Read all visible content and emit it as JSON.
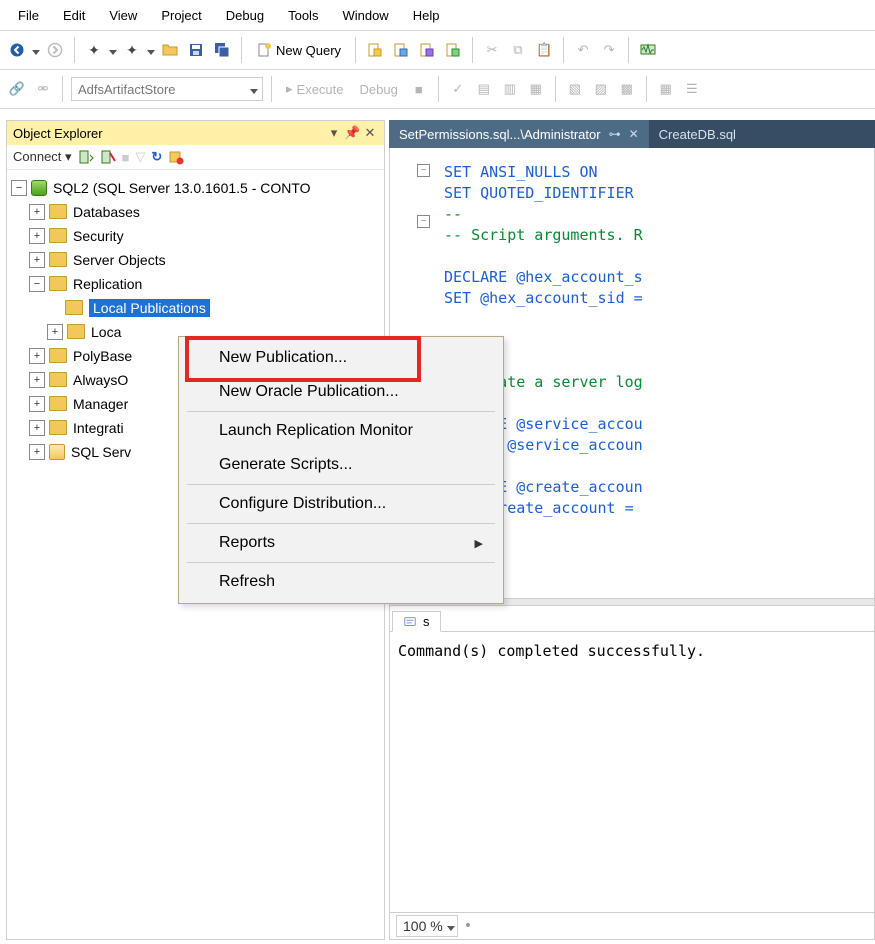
{
  "menu": [
    "File",
    "Edit",
    "View",
    "Project",
    "Debug",
    "Tools",
    "Window",
    "Help"
  ],
  "toolbar1": {
    "new_query": "New Query"
  },
  "toolbar2": {
    "database_combo": "AdfsArtifactStore",
    "execute": "Execute",
    "debug": "Debug"
  },
  "object_explorer": {
    "title": "Object Explorer",
    "connect_label": "Connect",
    "server": "SQL2 (SQL Server 13.0.1601.5 - CONTO",
    "nodes": {
      "databases": "Databases",
      "security": "Security",
      "server_objects": "Server Objects",
      "replication": "Replication",
      "local_publications": "Local Publications",
      "local_subscriptions": "Loca",
      "polybase": "PolyBase",
      "alwayson": "AlwaysO",
      "management": "Manager",
      "integration": "Integrati",
      "sql_agent": "SQL Serv"
    }
  },
  "document_tabs": {
    "active": "SetPermissions.sql...\\Administrator",
    "inactive": "CreateDB.sql"
  },
  "code_lines": [
    {
      "cls": "kw",
      "text": "SET ANSI_NULLS ON"
    },
    {
      "cls": "kw",
      "text": "SET QUOTED_IDENTIFIER "
    },
    {
      "cls": "cm",
      "text": "--"
    },
    {
      "cls": "cm",
      "text": "-- Script arguments. R"
    },
    {
      "cls": "",
      "text": ""
    },
    {
      "cls": "kw",
      "text": "DECLARE @hex_account_s"
    },
    {
      "cls": "kw",
      "text": "SET @hex_account_sid ="
    },
    {
      "cls": "",
      "text": ""
    },
    {
      "cls": "",
      "text": ""
    },
    {
      "cls": "cm",
      "text": "--"
    },
    {
      "cls": "cm",
      "text": "-- Create a server log"
    },
    {
      "cls": "",
      "text": ""
    },
    {
      "cls": "kw",
      "text": "DECLARE @service_accou"
    },
    {
      "cls": "kw",
      "text": "SELECT @service_accoun"
    },
    {
      "cls": "",
      "text": ""
    },
    {
      "cls": "kw",
      "text": "DECLARE @create_accoun"
    },
    {
      "cls": "kw",
      "text": "SET @create_account = "
    }
  ],
  "messages": {
    "tab_label": "s",
    "body": "Command(s) completed successfully."
  },
  "zoom": "100 %",
  "context_menu": {
    "new_publication": "New Publication...",
    "new_oracle_publication": "New Oracle Publication...",
    "launch_monitor": "Launch Replication Monitor",
    "generate_scripts": "Generate Scripts...",
    "configure_distribution": "Configure Distribution...",
    "reports": "Reports",
    "refresh": "Refresh"
  }
}
